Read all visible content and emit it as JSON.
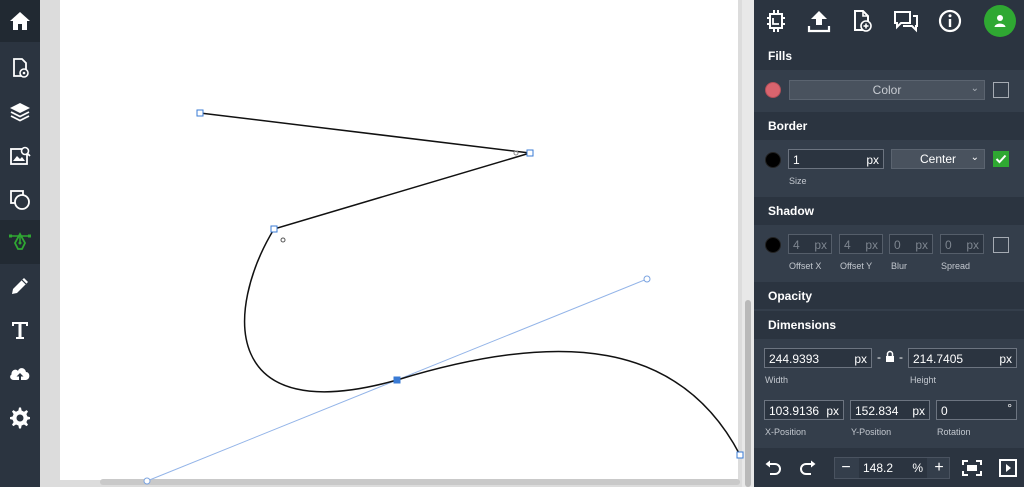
{
  "app": {
    "left_tools": [
      {
        "name": "home-icon"
      },
      {
        "name": "page-settings-icon"
      },
      {
        "name": "layers-icon"
      },
      {
        "name": "image-search-icon"
      },
      {
        "name": "shapes-icon"
      },
      {
        "name": "pen-tool-icon",
        "active": true
      },
      {
        "name": "pencil-icon"
      },
      {
        "name": "text-icon"
      },
      {
        "name": "upload-cloud-icon"
      },
      {
        "name": "settings-gear-icon"
      }
    ],
    "top_icons": [
      "crop-tool-icon",
      "upload-icon",
      "add-page-icon",
      "comments-icon",
      "info-icon",
      "user-avatar-icon"
    ],
    "colors": {
      "accent_green": "#2fa832",
      "fill_swatch": "#d9646e",
      "border_swatch": "#000000",
      "panel_bg": "#343e4b",
      "header_bg": "#2b3440",
      "selection_blue": "#93b4e8"
    }
  },
  "panel": {
    "fills": {
      "title": "Fills",
      "type_label": "Color",
      "enabled": false
    },
    "border": {
      "title": "Border",
      "size_value": "1",
      "size_unit": "px",
      "size_label": "Size",
      "position_value": "Center",
      "enabled": true
    },
    "shadow": {
      "title": "Shadow",
      "offset_x": "4",
      "offset_y": "4",
      "blur": "0",
      "spread": "0",
      "unit": "px",
      "labels": {
        "offset_x": "Offset X",
        "offset_y": "Offset Y",
        "blur": "Blur",
        "spread": "Spread"
      },
      "enabled": false
    },
    "opacity": {
      "title": "Opacity"
    },
    "dimensions": {
      "title": "Dimensions",
      "width": "244.9393",
      "height": "214.7405",
      "x": "103.9136",
      "y": "152.834",
      "rotation": "0",
      "unit": "px",
      "rotation_unit": "°",
      "labels": {
        "width": "Width",
        "height": "Height",
        "x": "X-Position",
        "y": "Y-Position",
        "rotation": "Rotation"
      },
      "lock_dash_left": "-",
      "lock_dash_right": "-"
    }
  },
  "bottom_bar": {
    "zoom_value": "148.2",
    "zoom_unit": "%",
    "zoom_minus": "−",
    "zoom_plus": "+"
  }
}
